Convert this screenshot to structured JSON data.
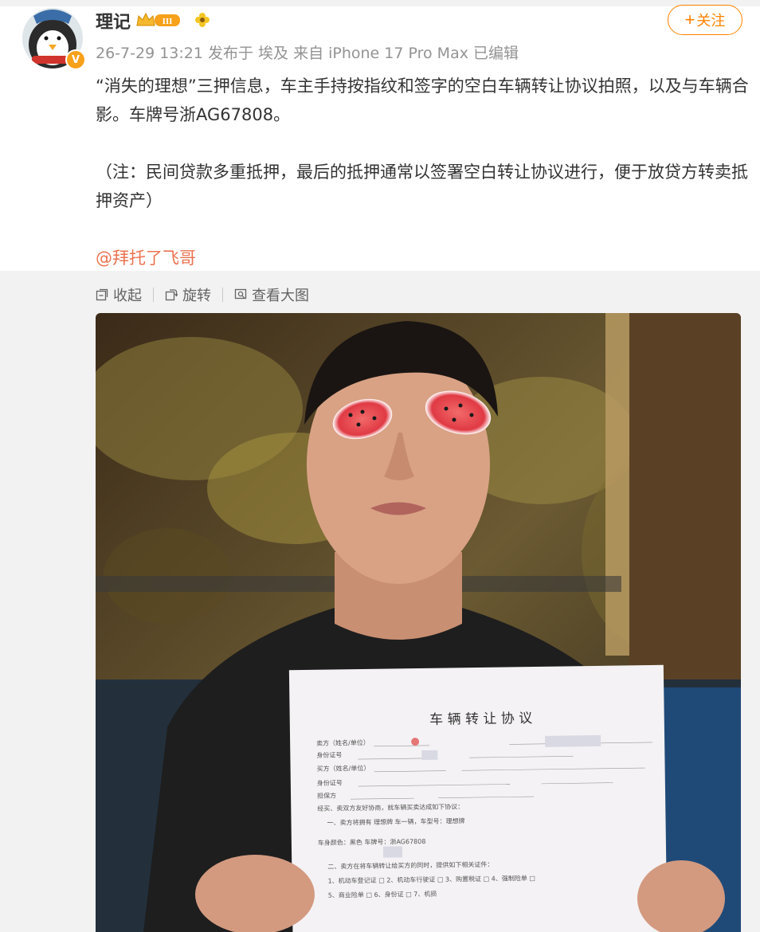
{
  "user": {
    "name": "理记",
    "level_badge": "III",
    "verified_mark": "V"
  },
  "post": {
    "meta": "26-7-29 13:21 发布于 埃及 来自 iPhone 17 Pro Max 已编辑",
    "paragraph1": "“消失的理想”三押信息，车主手持按指纹和签字的空白车辆转让协议拍照，以及与车辆合影。车牌号浙AG67808。",
    "paragraph2": "（注：民间贷款多重抵押，最后的抵押通常以签署空白转让协议进行，便于放贷方转卖抵押资产）",
    "mention": "@拜托了飞哥"
  },
  "follow_button": {
    "plus": "+",
    "label": "关注"
  },
  "toolbar": {
    "collapse": "收起",
    "rotate": "旋转",
    "view_large": "查看大图"
  },
  "photo": {
    "document_title": "车 辆 转 让 协 议",
    "document_line1": "卖方（姓名/单位）",
    "document_line2": "身份证号",
    "document_line3": "买方（姓名/单位）",
    "document_line4": "身份证号",
    "document_line5": "担保方",
    "document_line6": "经买、卖双方友好协商，就车辆买卖达成如下协议：",
    "document_line7": "一、卖方将拥有 理想牌 车一辆，车型号：理想牌",
    "document_line8": "车身颜色：黑色 车牌号：浙AG67808",
    "document_line9": "二、卖方在将车辆转让给买方的同时，提供如下相关证件：",
    "document_line10": "1、机动车登记证 □ 2、机动车行驶证 □ 3、购置税证 □ 4、强制险单 □",
    "document_line11": "5、商业险单 □ 6、身份证 □ 7、机损"
  },
  "colors": {
    "accent": "#ff8200",
    "mention": "#eb7350",
    "meta": "#939393",
    "text": "#333333"
  },
  "icons": [
    "verified-icon",
    "crown-level-icon",
    "flower-icon",
    "collapse-icon",
    "rotate-icon",
    "view-large-icon"
  ]
}
